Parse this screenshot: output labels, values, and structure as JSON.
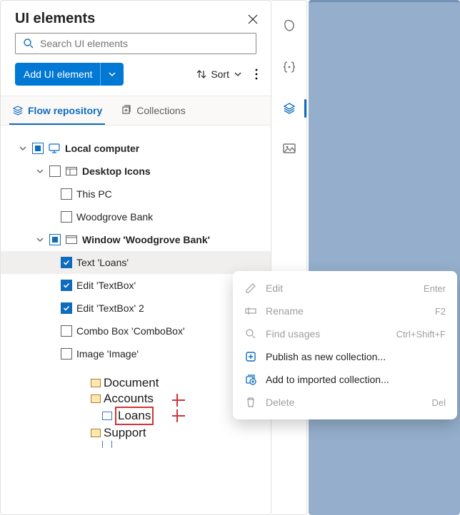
{
  "header": {
    "title": "UI elements"
  },
  "search": {
    "placeholder": "Search UI elements"
  },
  "toolbar": {
    "add_label": "Add UI element",
    "sort_label": "Sort"
  },
  "tabs": {
    "flow": "Flow repository",
    "collections": "Collections"
  },
  "tree": {
    "root": "Local computer",
    "desktop": "Desktop Icons",
    "thispc": "This PC",
    "wgbank": "Woodgrove Bank",
    "window": "Window 'Woodgrove Bank'",
    "text_loans": "Text 'Loans'",
    "edit_tb": "Edit 'TextBox'",
    "edit_tb2": "Edit 'TextBox' 2",
    "combo": "Combo Box 'ComboBox'",
    "image": "Image 'Image'"
  },
  "preview": {
    "document": "Document",
    "accounts": "Accounts",
    "loans": "Loans",
    "support": "Support"
  },
  "menu": {
    "edit": "Edit",
    "edit_k": "Enter",
    "rename": "Rename",
    "rename_k": "F2",
    "find": "Find usages",
    "find_k": "Ctrl+Shift+F",
    "publish": "Publish as new collection...",
    "addimp": "Add to imported collection...",
    "delete": "Delete",
    "delete_k": "Del"
  }
}
